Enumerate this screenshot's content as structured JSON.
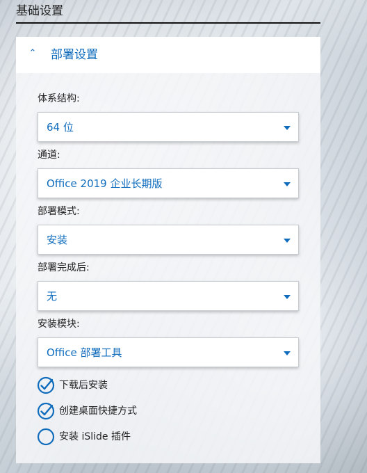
{
  "section_title": "基础设置",
  "panel": {
    "title": "部署设置",
    "chevron_icon": "chevron-up-icon"
  },
  "fields": [
    {
      "label": "体系结构:",
      "value": "64 位"
    },
    {
      "label": "通道:",
      "value": "Office 2019 企业长期版"
    },
    {
      "label": "部署模式:",
      "value": "安装"
    },
    {
      "label": "部署完成后:",
      "value": "无"
    },
    {
      "label": "安装模块:",
      "value": "Office 部署工具"
    }
  ],
  "options": [
    {
      "label": "下载后安装",
      "checked": true
    },
    {
      "label": "创建桌面快捷方式",
      "checked": true
    },
    {
      "label": "安装 iSlide 插件",
      "checked": false
    }
  ],
  "colors": {
    "accent": "#0f6cbd",
    "text": "#222222",
    "panel_header_bg": "#ffffff"
  }
}
